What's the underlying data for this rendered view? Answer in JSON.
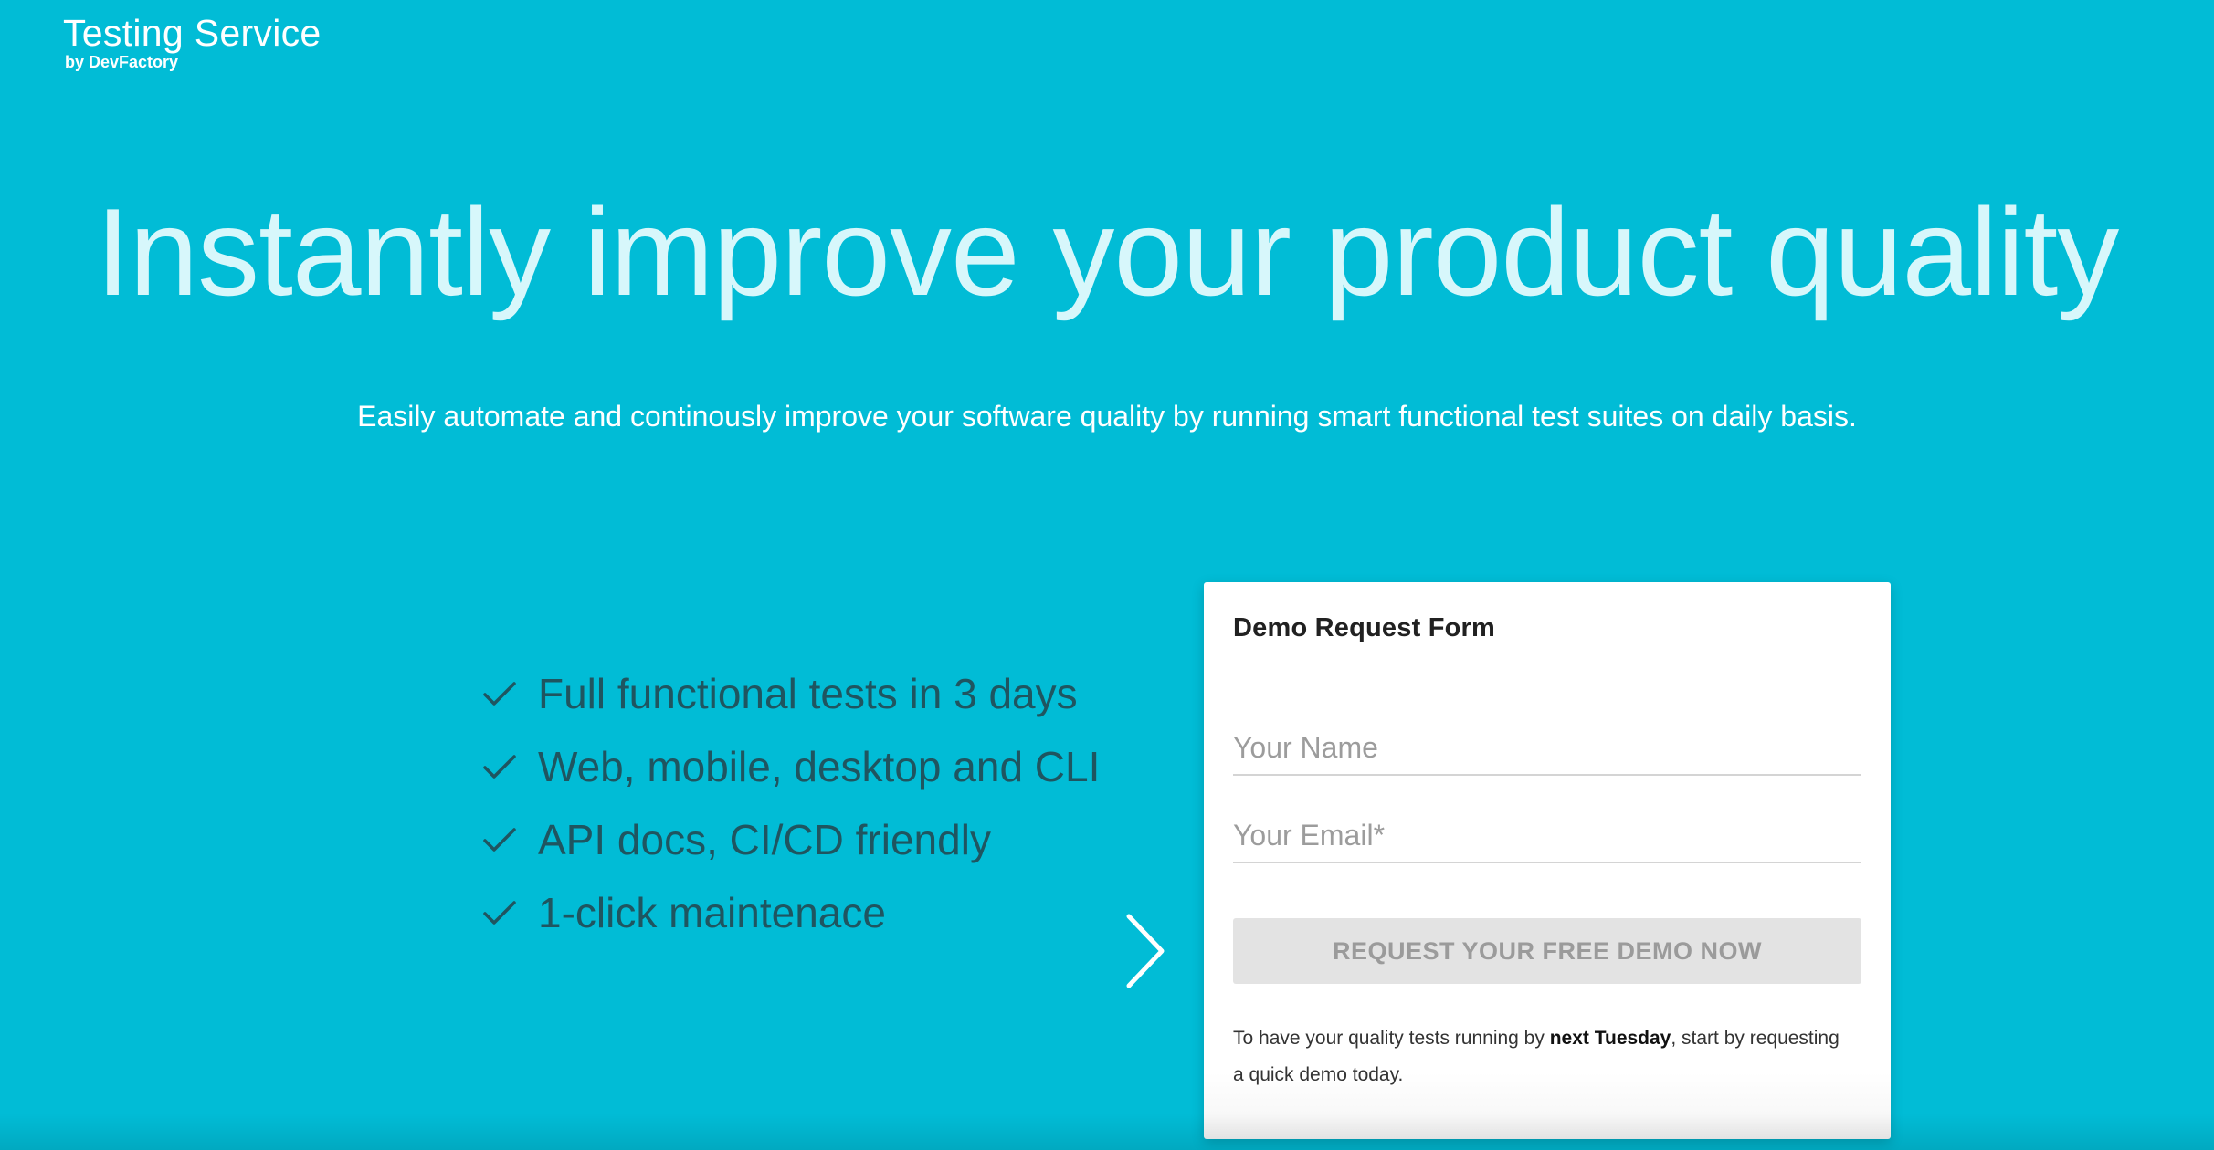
{
  "brand": {
    "title": "Testing Service",
    "subtitle": "by DevFactory"
  },
  "hero": {
    "title": "Instantly improve your product quality",
    "subtitle": "Easily automate and continously improve your software quality by running smart functional test suites on daily basis."
  },
  "features": [
    {
      "label": "Full functional tests in 3 days",
      "icon": "check-icon"
    },
    {
      "label": "Web, mobile, desktop and CLI",
      "icon": "check-icon"
    },
    {
      "label": "API docs, CI/CD friendly",
      "icon": "check-icon"
    },
    {
      "label": "1-click maintenace",
      "icon": "check-icon"
    }
  ],
  "navigation": {
    "next_icon": "chevron-right-icon"
  },
  "form": {
    "title": "Demo Request Form",
    "name_placeholder": "Your Name",
    "name_value": "",
    "email_placeholder": "Your Email*",
    "email_value": "",
    "submit_label": "REQUEST YOUR FREE DEMO NOW",
    "note_before": "To have your quality tests running by ",
    "note_bold": "next Tuesday",
    "note_after": ", start by requesting a quick demo today."
  },
  "colors": {
    "background": "#01bcd6",
    "hero_title": "#d7f7fb",
    "feature_text": "#1f5560",
    "button_bg": "#e3e3e3",
    "button_text": "#9b9b9b"
  }
}
